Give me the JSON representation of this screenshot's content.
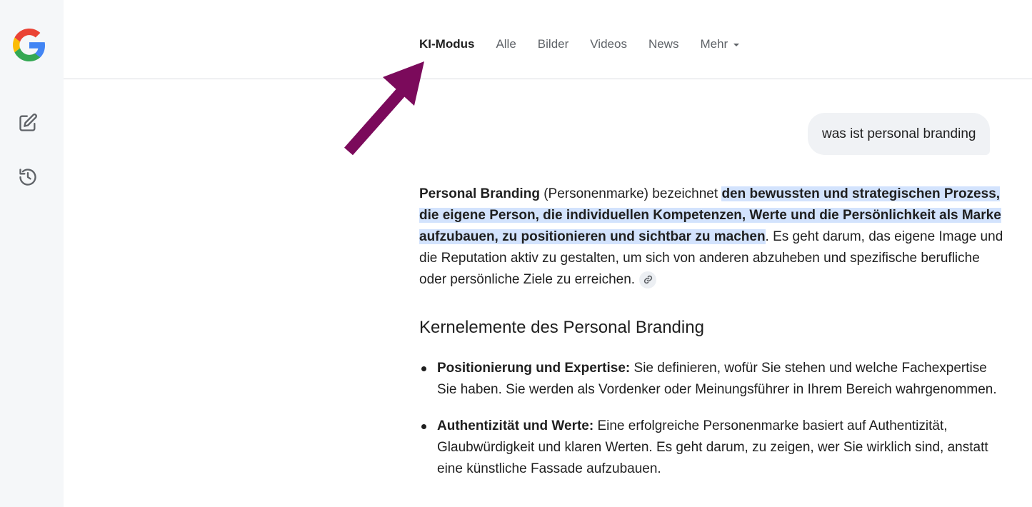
{
  "tabs": [
    {
      "label": "KI-Modus",
      "active": true
    },
    {
      "label": "Alle"
    },
    {
      "label": "Bilder"
    },
    {
      "label": "Videos"
    },
    {
      "label": "News"
    },
    {
      "label": "Mehr"
    }
  ],
  "sidebar": {
    "logo_icon": "google-logo-icon",
    "new_chat_icon": "edit-icon",
    "history_icon": "history-icon"
  },
  "annotation": {
    "arrow_color": "#7b0a5b"
  },
  "query": "was ist personal branding",
  "answer": {
    "term": "Personal Branding",
    "term_paren": " (Personenmarke) bezeichnet ",
    "highlight": "den bewussten und strategischen Prozess, die eigene Person, die individuellen Kompetenzen, Werte und die Persönlichkeit als Marke aufzubauen, zu positionieren und sichtbar zu machen",
    "rest": ". Es geht darum, das eigene Image und die Reputation aktiv zu gestalten, um sich von anderen abzuheben und spezifische berufliche oder persönliche Ziele zu erreichen."
  },
  "section_title": "Kernelemente des Personal Branding",
  "bullets": [
    {
      "title": "Positionierung und Expertise:",
      "text": " Sie definieren, wofür Sie stehen und welche Fachexpertise Sie haben. Sie werden als Vordenker oder Meinungsführer in Ihrem Bereich wahrgenommen."
    },
    {
      "title": "Authentizität und Werte:",
      "text": " Eine erfolgreiche Personenmarke basiert auf Authentizität, Glaubwürdigkeit und klaren Werten. Es geht darum, zu zeigen, wer Sie wirklich sind, anstatt eine künstliche Fassade aufzubauen."
    }
  ],
  "colors": {
    "highlight_bg": "#d3e3fd",
    "sidebar_bg": "#f5f7f9",
    "query_bubble_bg": "#f0f2f5"
  }
}
